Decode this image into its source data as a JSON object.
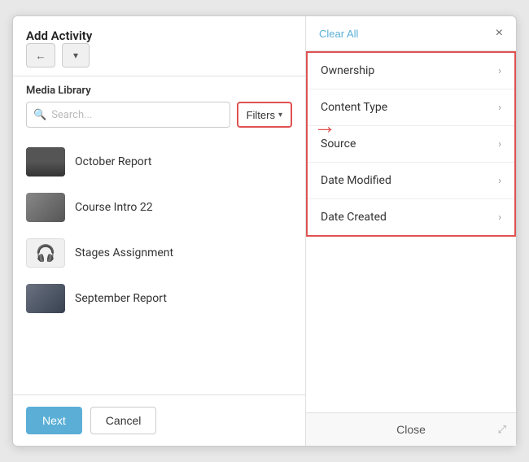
{
  "leftPanel": {
    "title": "Add Activity",
    "sectionLabel": "Media Library",
    "search": {
      "placeholder": "Search..."
    },
    "filtersButton": "Filters",
    "mediaItems": [
      {
        "name": "October Report",
        "type": "video",
        "thumbColor": "#555"
      },
      {
        "name": "Course Intro 22",
        "type": "video",
        "thumbColor": "#666"
      },
      {
        "name": "Stages Assignment",
        "type": "audio"
      },
      {
        "name": "September Report",
        "type": "video",
        "thumbColor": "#4a5568"
      }
    ],
    "nextButton": "Next",
    "cancelButton": "Cancel"
  },
  "rightPanel": {
    "clearAllLabel": "Clear All",
    "filterItems": [
      {
        "label": "Ownership"
      },
      {
        "label": "Content Type"
      },
      {
        "label": "Source"
      },
      {
        "label": "Date Modified"
      },
      {
        "label": "Date Created"
      }
    ],
    "closeLabel": "Close"
  },
  "icons": {
    "back": "←",
    "chevronDown": "▾",
    "search": "🔍",
    "close": "×",
    "chevronRight": "›",
    "audio": "🎧",
    "arrow": "→",
    "expand": "⤢"
  }
}
